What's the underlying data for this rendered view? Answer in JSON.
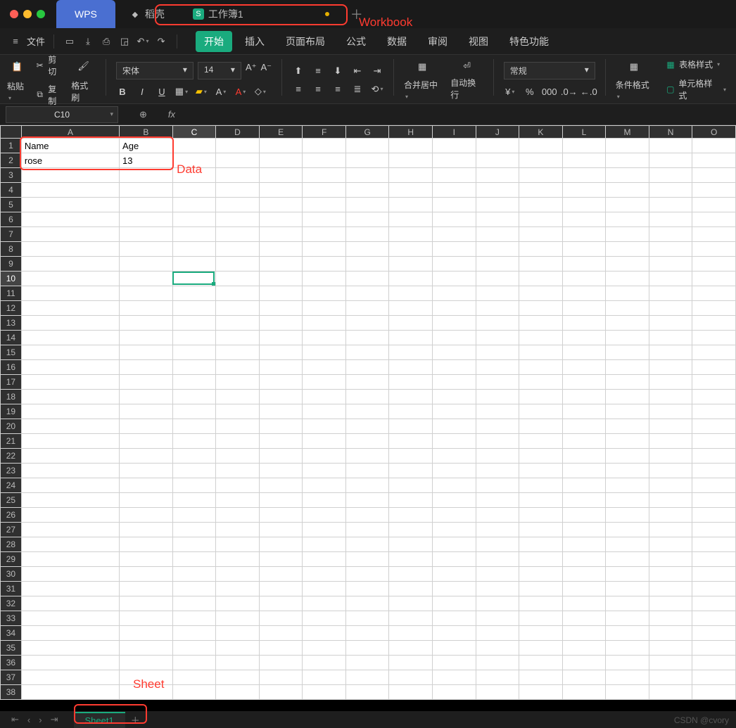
{
  "titlebar": {
    "wps_label": "WPS",
    "docer_label": "稻壳",
    "workbook_label": "工作簿1"
  },
  "annotations": {
    "workbook": "Workbook",
    "data": "Data",
    "sheet": "Sheet"
  },
  "menubar": {
    "file": "文件",
    "tabs": [
      "开始",
      "插入",
      "页面布局",
      "公式",
      "数据",
      "审阅",
      "视图",
      "特色功能"
    ]
  },
  "ribbon": {
    "cut": "剪切",
    "copy": "复制",
    "paste": "粘贴",
    "format_painter": "格式刷",
    "font_name": "宋体",
    "font_size": "14",
    "merge_center": "合并居中",
    "wrap_text": "自动换行",
    "num_format": "常规",
    "cond_fmt": "条件格式",
    "table_style": "表格样式",
    "cell_style": "单元格样式"
  },
  "namebox": "C10",
  "columns": [
    "A",
    "B",
    "C",
    "D",
    "E",
    "F",
    "G",
    "H",
    "I",
    "J",
    "K",
    "L",
    "M",
    "N",
    "O"
  ],
  "selected_col": "C",
  "selected_row": 10,
  "row_count": 38,
  "cells": {
    "A1": "Name",
    "B1": "Age",
    "A2": "rose",
    "B2": "13"
  },
  "sheet_tab": "Sheet1",
  "watermark": "CSDN @cvory"
}
